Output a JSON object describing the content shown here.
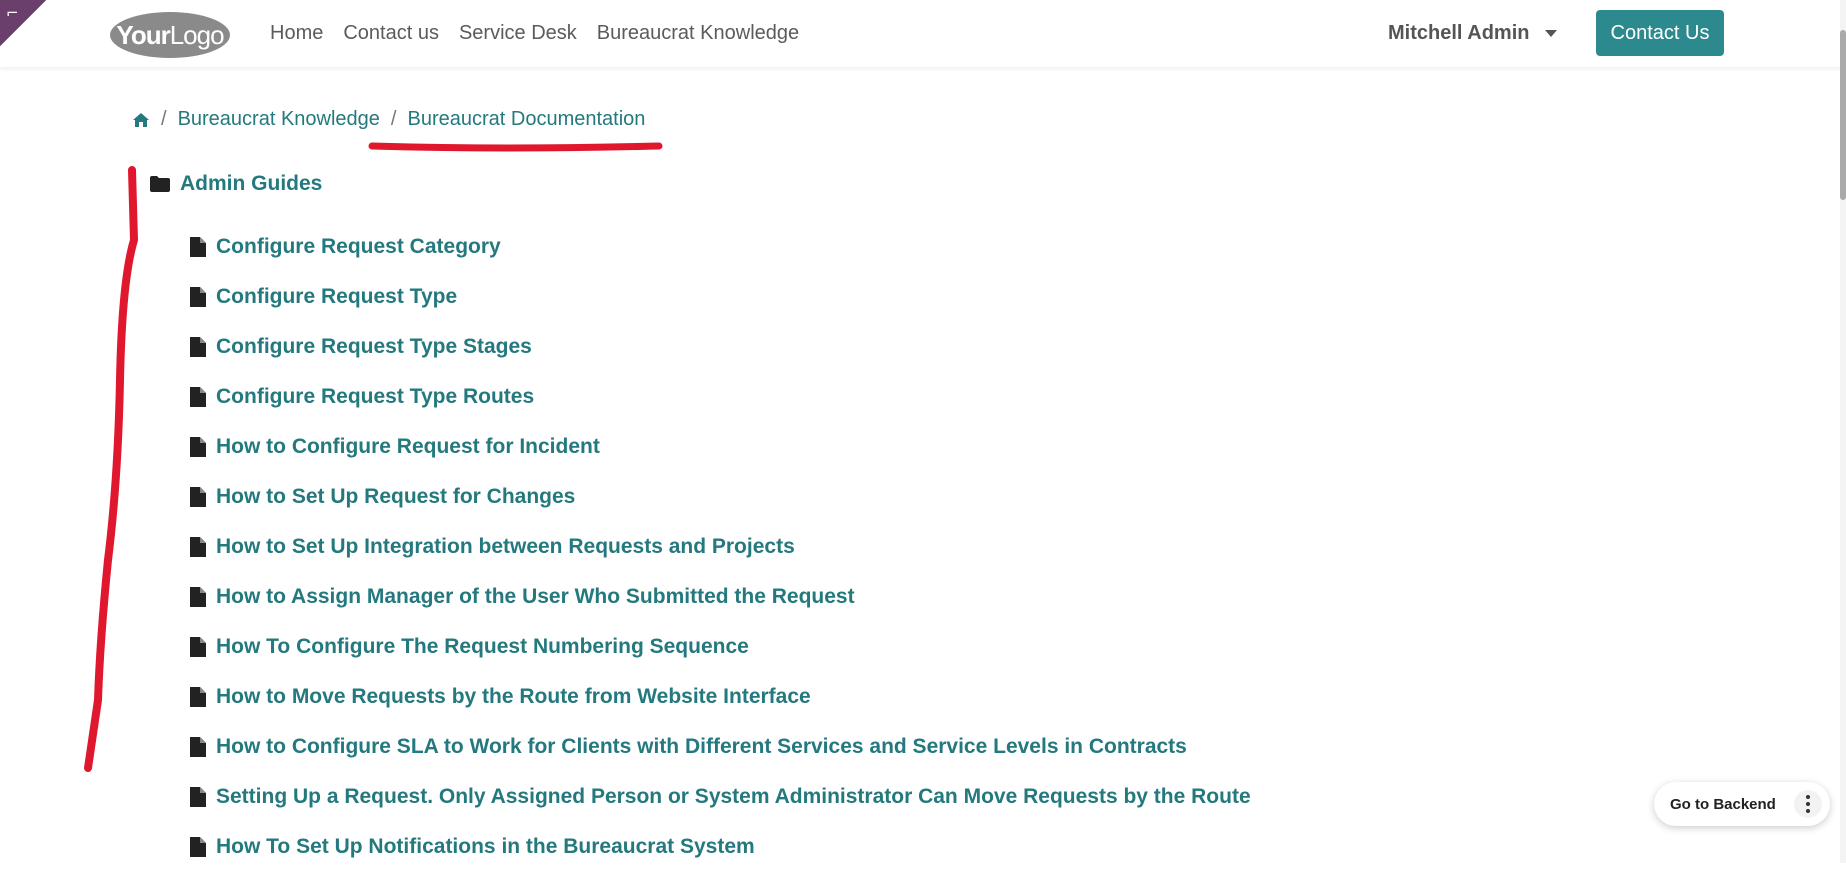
{
  "header": {
    "logo": {
      "bold": "Your",
      "light": "Logo"
    },
    "nav": [
      "Home",
      "Contact us",
      "Service Desk",
      "Bureaucrat Knowledge"
    ],
    "user": "Mitchell Admin",
    "contact_button": "Contact Us"
  },
  "breadcrumb": {
    "items": [
      "Bureaucrat Knowledge",
      "Bureaucrat Documentation"
    ],
    "separator": "/"
  },
  "tree": {
    "folder": "Admin Guides",
    "documents": [
      "Configure Request Category",
      "Configure Request Type",
      "Configure Request Type Stages",
      "Configure Request Type Routes",
      "How to Configure Request for Incident",
      "How to Set Up Request for Changes",
      "How to Set Up Integration between Requests and Projects",
      "How to Assign Manager of the User Who Submitted the Request",
      "How To Configure The Request Numbering Sequence",
      "How to Move Requests by the Route from Website Interface",
      "How to Configure SLA to Work for Clients with Different Services and Service Levels in Contracts",
      "Setting Up a Request. Only Assigned Person or System Administrator Can Move Requests by the Route",
      "How To Set Up Notifications in the Bureaucrat System"
    ]
  },
  "backend": {
    "label": "Go to Backend"
  },
  "colors": {
    "link": "#23797e",
    "primary": "#2c8a8e",
    "annotation": "#e0182d"
  }
}
